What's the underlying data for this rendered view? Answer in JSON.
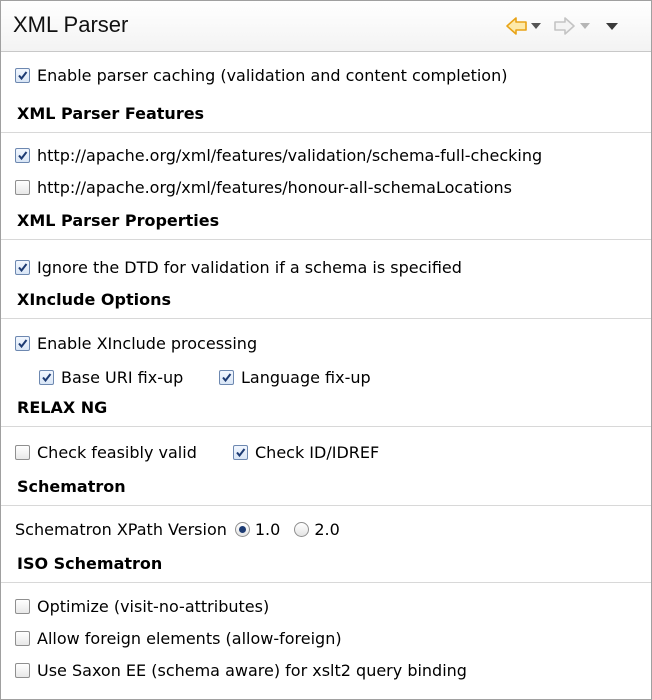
{
  "title": "XML Parser",
  "toolbar": {
    "back_icon": "back-arrow-icon",
    "forward_icon": "forward-arrow-icon",
    "menu_icon": "view-menu-icon",
    "accent": "#e8a317"
  },
  "options": {
    "enable_caching": {
      "label": "Enable parser caching (validation and content completion)",
      "checked": true
    },
    "features_heading": "XML Parser Features",
    "feature_full_checking": {
      "label": "http://apache.org/xml/features/validation/schema-full-checking",
      "checked": true
    },
    "feature_honour_locations": {
      "label": "http://apache.org/xml/features/honour-all-schemaLocations",
      "checked": false
    },
    "properties_heading": "XML Parser Properties",
    "ignore_dtd": {
      "label": "Ignore the DTD for validation if a schema is specified",
      "checked": true
    },
    "xinclude_heading": "XInclude Options",
    "enable_xinclude": {
      "label": "Enable XInclude processing",
      "checked": true
    },
    "base_uri_fixup": {
      "label": "Base URI fix-up",
      "checked": true
    },
    "language_fixup": {
      "label": "Language fix-up",
      "checked": true
    },
    "relaxng_heading": "RELAX NG",
    "check_feasibly_valid": {
      "label": "Check feasibly valid",
      "checked": false
    },
    "check_id_idref": {
      "label": "Check ID/IDREF",
      "checked": true
    },
    "schematron_heading": "Schematron",
    "xpath_version_label": "Schematron XPath Version",
    "xpath_v1": {
      "label": "1.0",
      "selected": true
    },
    "xpath_v2": {
      "label": "2.0",
      "selected": false
    },
    "iso_heading": "ISO Schematron",
    "optimize": {
      "label": "Optimize (visit-no-attributes)",
      "checked": false
    },
    "allow_foreign": {
      "label": "Allow foreign elements (allow-foreign)",
      "checked": false
    },
    "use_saxon_ee": {
      "label": "Use Saxon EE (schema aware) for xslt2 query binding",
      "checked": false
    }
  }
}
